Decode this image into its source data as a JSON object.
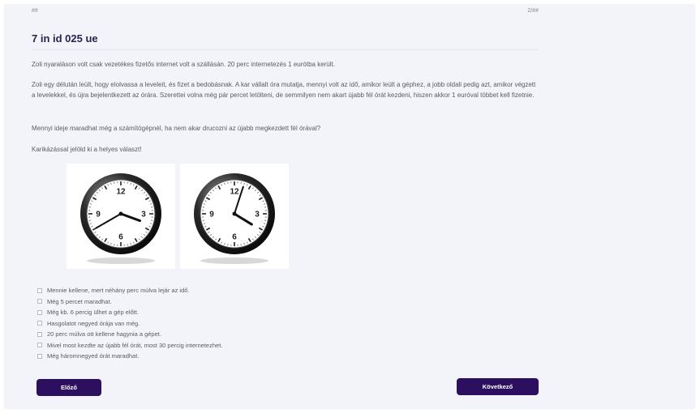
{
  "header": {
    "left_label": "##",
    "right_label": "2/##",
    "title": "7 in id 025 ue"
  },
  "paragraphs": [
    "Zoli nyaraláson volt csak vezetékes fizetős internet volt a szállásán. 20 perc internetezés 1 eurótba került.",
    "Zoli egy délután leült, hogy elolvassa a leveleit, és fizet a bedobásnak. A kar vállalt óra mutatja, mennyi volt az idő, amikor leült a géphez, a jobb oldali pedig azt, amikor végzett a levelekkel, és újra bejelentkezett az órára. Szerettei volna még pár percet letölteni, de semmilyen nem akart újabb fél órát kezdeni, hiszen akkor 1 euróval többet kell fizetnie.",
    "Mennyi ideje maradhat még a számítógépnél, ha nem akar drucozni az újabb megkezdett fél órával?",
    "Karikázással jelöld ki a helyes választ!"
  ],
  "clocks": [
    {
      "name": "left-clock",
      "hour": 3,
      "minute": 40
    },
    {
      "name": "right-clock",
      "hour": 4,
      "minute": 3
    }
  ],
  "options": [
    "Mennie kellene, mert néhány perc múlva lejár az idő.",
    "Még 5 percet maradhat.",
    "Még kb. 6 percig ülhet a gép előtt.",
    "Hasgolatot negyed órája van még.",
    "20 perc múlva ott kellene hagynia a gépet.",
    "Mivel most kezdte az újabb fél órát, most 30 percig internetezhet.",
    "Még háromnegyed órát maradhat."
  ],
  "buttons": {
    "back": "Előző",
    "next": "Következő"
  },
  "colors": {
    "page_bg": "#f2f4f9",
    "button_bg": "#2c0f5f",
    "title": "#2b1f4c"
  }
}
